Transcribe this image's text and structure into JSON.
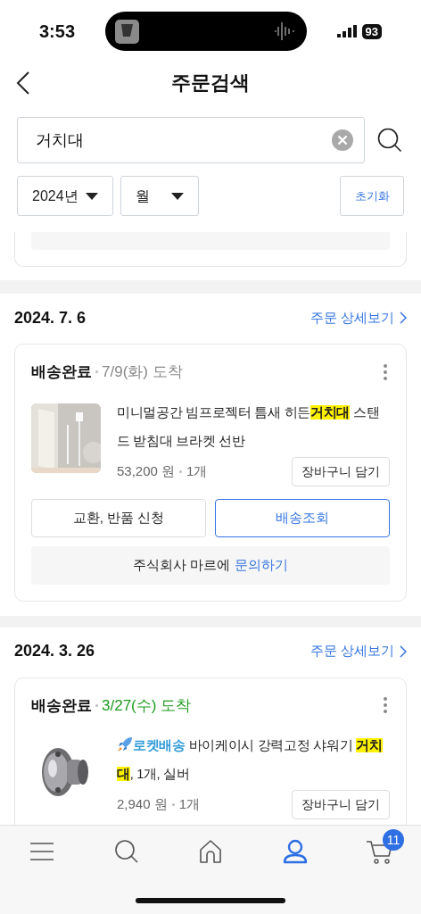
{
  "status_bar": {
    "time": "3:53",
    "battery": "93"
  },
  "header": {
    "title": "주문검색"
  },
  "search": {
    "value": "거치대"
  },
  "filters": [
    {
      "label": "2024년"
    },
    {
      "label": "월"
    }
  ],
  "reset_button": "초기화",
  "orders": [
    {
      "date": "2024. 7. 6",
      "detail_link": "주문 상세보기",
      "status": "배송완료",
      "arrival": "7/9(화) 도착",
      "arrival_highlight": false,
      "product": {
        "title": [
          {
            "text": "미니멀공간 빔프로젝터 틈새 히든",
            "highlight": false
          },
          {
            "text": "거치대",
            "highlight": true
          },
          {
            "text": " 스탠드 받침대 브라켓 선반",
            "highlight": false
          }
        ],
        "price": "53,200 원",
        "qty": "1개",
        "cart_button": "장바구니 담기"
      },
      "actions": [
        {
          "label": "교환, 반품 신청",
          "primary": false
        },
        {
          "label": "배송조회",
          "primary": true
        }
      ],
      "inquiry": {
        "seller": "주식회사 마르에",
        "link": "문의하기"
      }
    },
    {
      "date": "2024. 3. 26",
      "detail_link": "주문 상세보기",
      "status": "배송완료",
      "arrival": "3/27(수) 도착",
      "arrival_highlight": true,
      "product": {
        "badge": "로켓배송",
        "title": [
          {
            "text": " 바이케이시 강력고정 샤워기 ",
            "highlight": false
          },
          {
            "text": "거치대",
            "highlight": true
          },
          {
            "text": ", 1개, 실버",
            "highlight": false
          }
        ],
        "price": "2,940 원",
        "qty": "1개",
        "cart_button": "장바구니 담기"
      }
    }
  ],
  "tab_bar": [
    {
      "kind": "menu",
      "selected": false
    },
    {
      "kind": "search",
      "selected": false
    },
    {
      "kind": "home",
      "selected": false
    },
    {
      "kind": "profile",
      "selected": true
    },
    {
      "kind": "cart",
      "selected": false,
      "badge": "11"
    }
  ]
}
